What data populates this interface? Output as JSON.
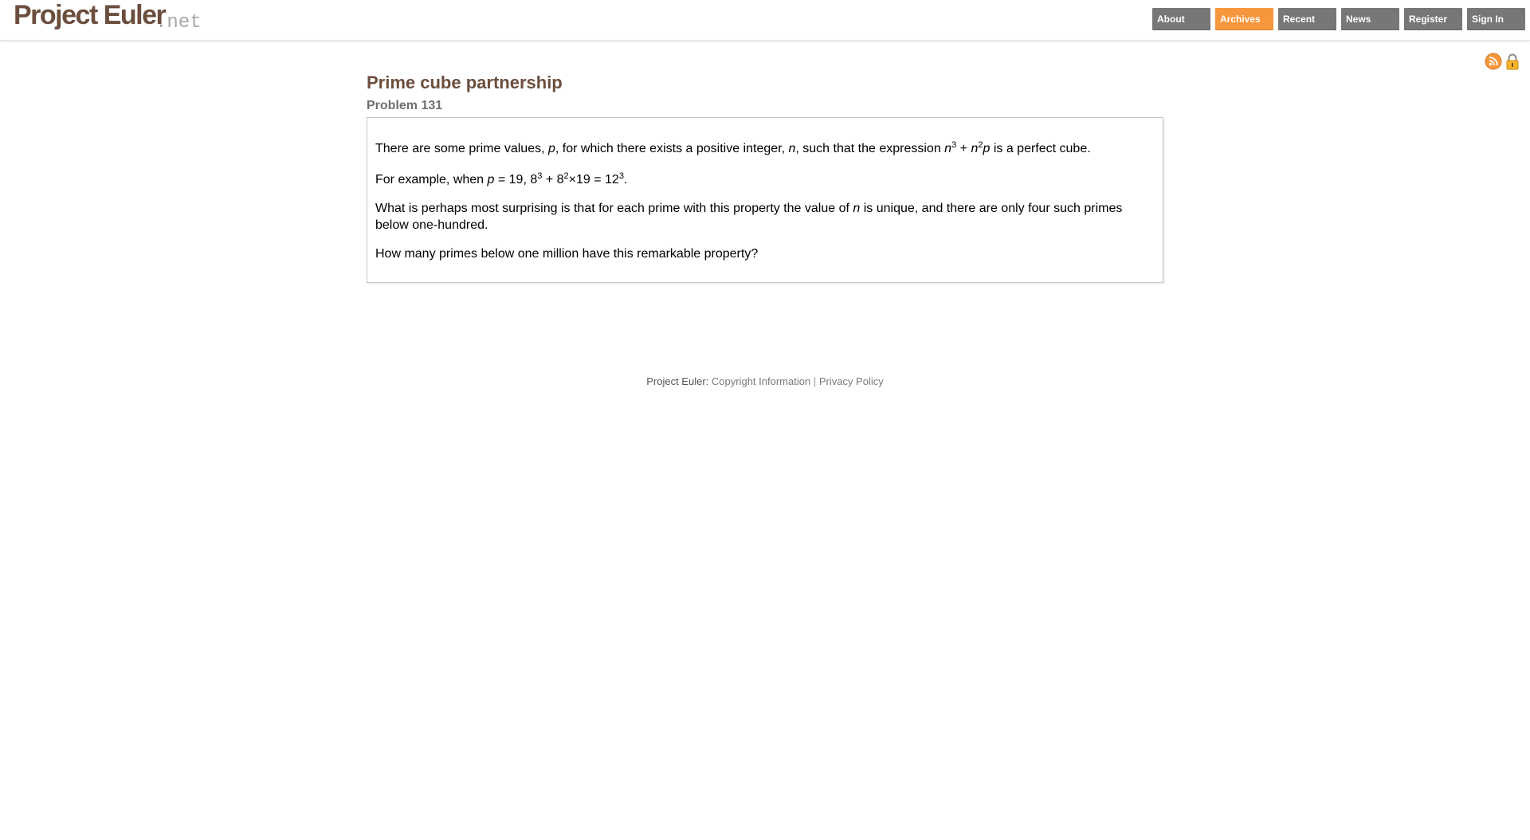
{
  "logo": {
    "main": "Project Euler",
    "suffix": ".net"
  },
  "nav": {
    "about": "About",
    "archives": "Archives",
    "recent": "Recent",
    "news": "News",
    "register": "Register",
    "sign_in": "Sign In"
  },
  "icons": [
    "rss-icon",
    "lock-icon"
  ],
  "colors": {
    "brand_brown": "#6b4e3d",
    "nav_button": "#777777",
    "nav_active": "#f7973d",
    "icon_orange": "#f7973d"
  },
  "problem": {
    "title": "Prime cube partnership",
    "number": "Problem 131",
    "p1": {
      "a": "There are some prime values, ",
      "p": "p",
      "b": ", for which there exists a positive integer, ",
      "n": "n",
      "c": ", such that the expression ",
      "n1": "n",
      "e1": "3",
      "plus": " + ",
      "n2": "n",
      "e2": "2",
      "p2": "p",
      "d": " is a perfect cube."
    },
    "p2": {
      "a": "For example, when ",
      "p": "p",
      "b": " = 19, 8",
      "e1": "3",
      "c": " + 8",
      "e2": "2",
      "d": "×19 = 12",
      "e3": "3",
      "f": "."
    },
    "p3": {
      "a": "What is perhaps most surprising is that for each prime with this property the value of ",
      "n": "n",
      "b": " is unique, and there are only four such primes below one-hundred."
    },
    "p4": "How many primes below one million have this remarkable property?"
  },
  "footer": {
    "label": "Project Euler:",
    "copyright": "Copyright Information",
    "separator": "|",
    "privacy": "Privacy Policy"
  }
}
